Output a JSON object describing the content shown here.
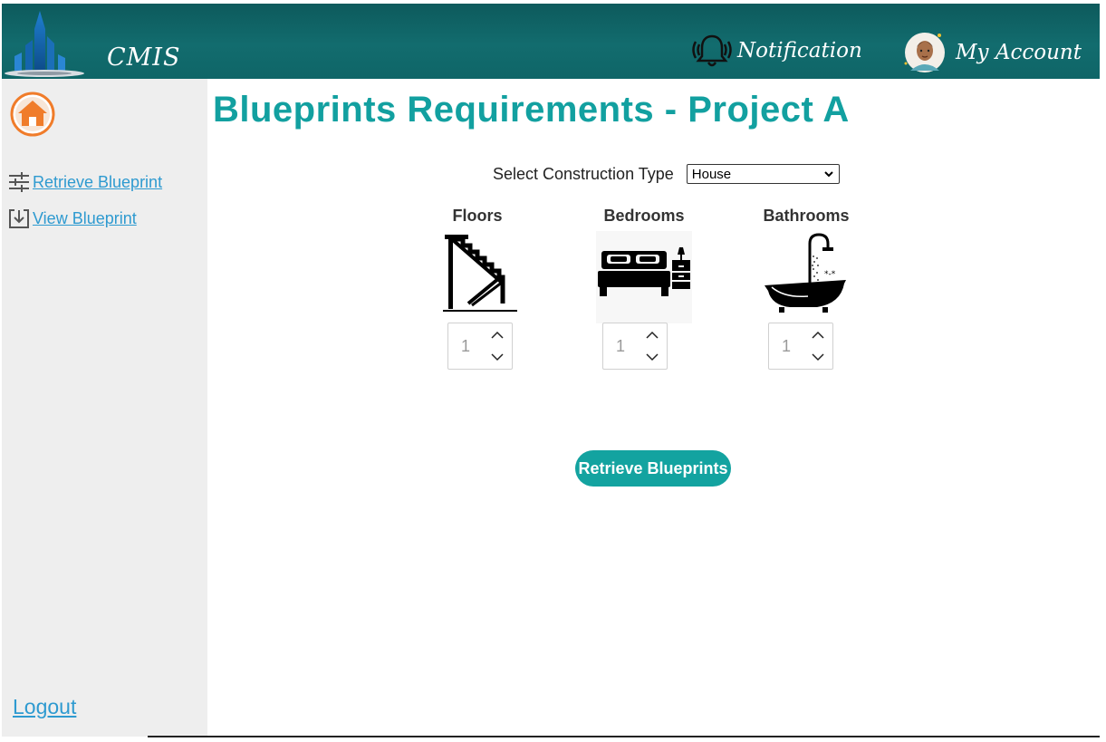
{
  "header": {
    "app_name": "CMIS",
    "notification_label": "Notification",
    "account_label": "My Account"
  },
  "sidebar": {
    "items": [
      {
        "label": "Retrieve Blueprint",
        "icon": "sliders-icon"
      },
      {
        "label": "View Blueprint",
        "icon": "download-box-icon"
      }
    ],
    "logout_label": "Logout"
  },
  "main": {
    "title": "Blueprints Requirements - Project A",
    "construction_type_label": "Select Construction Type",
    "construction_type_value": "House",
    "requirements": [
      {
        "label": "Floors",
        "value": "1",
        "icon": "stairs-icon"
      },
      {
        "label": "Bedrooms",
        "value": "1",
        "icon": "bed-icon"
      },
      {
        "label": "Bathrooms",
        "value": "1",
        "icon": "bathtub-icon"
      }
    ],
    "submit_label": "Retrieve Blueprints"
  },
  "colors": {
    "header_bg": "#0f6567",
    "title": "#12a0a0",
    "accent": "#13a3a0",
    "link": "#2e9ad0",
    "home_icon": "#f07c2a",
    "sidebar_bg": "#eeeeee"
  }
}
